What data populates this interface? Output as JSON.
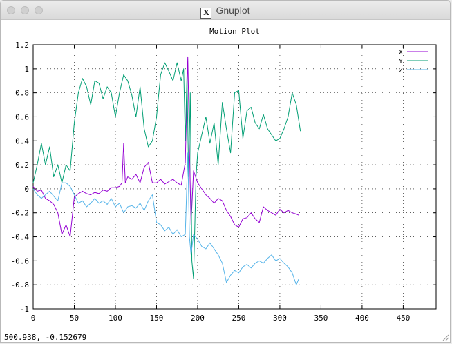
{
  "window": {
    "title": "Gnuplot",
    "app_icon": "x11-icon"
  },
  "status": {
    "coords": "500.938, -0.152679"
  },
  "chart_data": {
    "type": "line",
    "title": "Motion Plot",
    "xlim": [
      0,
      490
    ],
    "ylim": [
      -1,
      1.2
    ],
    "xticks": [
      "0",
      "50",
      "100",
      "150",
      "200",
      "250",
      "300",
      "350",
      "400",
      "450"
    ],
    "xtick_values": [
      0,
      50,
      100,
      150,
      200,
      250,
      300,
      350,
      400,
      450
    ],
    "yticks": [
      "-1",
      "-0.8",
      "-0.6",
      "-0.4",
      "-0.2",
      "0",
      "0.2",
      "0.4",
      "0.6",
      "0.8",
      "1",
      "1.2"
    ],
    "ytick_values": [
      -1,
      -0.8,
      -0.6,
      -0.4,
      -0.2,
      0,
      0.2,
      0.4,
      0.6,
      0.8,
      1,
      1.2
    ],
    "grid": true,
    "legend_position": "top-right",
    "series": [
      {
        "name": "X",
        "color": "#9400d3",
        "x": [
          0,
          5,
          10,
          15,
          20,
          25,
          30,
          35,
          40,
          45,
          50,
          55,
          60,
          65,
          70,
          75,
          80,
          85,
          90,
          95,
          100,
          105,
          108,
          110,
          112,
          115,
          120,
          125,
          130,
          135,
          140,
          145,
          150,
          155,
          160,
          165,
          170,
          175,
          180,
          185,
          188,
          190,
          192,
          195,
          200,
          205,
          210,
          215,
          220,
          225,
          230,
          235,
          240,
          245,
          250,
          255,
          260,
          265,
          270,
          275,
          280,
          285,
          290,
          295,
          300,
          305,
          310,
          315,
          320,
          323
        ],
        "y": [
          0.02,
          -0.02,
          -0.01,
          -0.08,
          -0.1,
          -0.13,
          -0.2,
          -0.38,
          -0.3,
          -0.4,
          -0.07,
          -0.04,
          -0.02,
          -0.04,
          -0.05,
          -0.03,
          -0.04,
          -0.01,
          -0.02,
          0.01,
          0.01,
          0.02,
          0.05,
          0.38,
          0.05,
          0.1,
          0.08,
          0.12,
          0.05,
          0.18,
          0.22,
          0.05,
          0.05,
          0.08,
          0.04,
          0.06,
          0.08,
          0.05,
          0.03,
          0.22,
          1.1,
          0.35,
          -0.3,
          0.15,
          0.05,
          0.0,
          -0.05,
          -0.08,
          -0.12,
          -0.08,
          -0.1,
          -0.18,
          -0.23,
          -0.3,
          -0.32,
          -0.25,
          -0.24,
          -0.2,
          -0.25,
          -0.28,
          -0.15,
          -0.18,
          -0.2,
          -0.22,
          -0.17,
          -0.2,
          -0.18,
          -0.2,
          -0.21,
          -0.22
        ]
      },
      {
        "name": "Y",
        "color": "#009e73",
        "x": [
          0,
          5,
          10,
          15,
          20,
          25,
          30,
          35,
          40,
          45,
          50,
          55,
          60,
          65,
          70,
          75,
          80,
          85,
          90,
          95,
          100,
          105,
          110,
          115,
          120,
          125,
          130,
          135,
          140,
          145,
          150,
          155,
          160,
          165,
          170,
          175,
          180,
          183,
          185,
          187,
          189,
          191,
          193,
          195,
          198,
          200,
          205,
          210,
          215,
          220,
          225,
          230,
          235,
          240,
          245,
          250,
          255,
          260,
          265,
          270,
          275,
          280,
          285,
          290,
          295,
          300,
          305,
          310,
          315,
          320,
          325
        ],
        "y": [
          0.05,
          0.2,
          0.38,
          0.2,
          0.35,
          0.1,
          0.2,
          0.05,
          0.2,
          0.15,
          0.55,
          0.8,
          0.92,
          0.85,
          0.7,
          0.9,
          0.88,
          0.75,
          0.85,
          0.8,
          0.6,
          0.8,
          0.95,
          0.9,
          0.78,
          0.6,
          0.85,
          0.5,
          0.35,
          0.4,
          0.6,
          0.95,
          1.05,
          0.98,
          0.9,
          1.05,
          0.9,
          1.0,
          0.4,
          0.95,
          0.1,
          0.8,
          -0.6,
          -0.75,
          0.1,
          0.3,
          0.45,
          0.6,
          0.38,
          0.55,
          0.2,
          0.72,
          0.5,
          0.3,
          0.8,
          0.82,
          0.42,
          0.65,
          0.68,
          0.55,
          0.5,
          0.62,
          0.5,
          0.45,
          0.4,
          0.42,
          0.5,
          0.6,
          0.8,
          0.7,
          0.48
        ]
      },
      {
        "name": "Z",
        "color": "#56b4e9",
        "x": [
          0,
          5,
          10,
          15,
          20,
          25,
          30,
          35,
          40,
          45,
          50,
          55,
          60,
          65,
          70,
          75,
          80,
          85,
          90,
          95,
          100,
          105,
          110,
          115,
          120,
          125,
          130,
          135,
          140,
          145,
          150,
          155,
          160,
          165,
          170,
          175,
          180,
          185,
          188,
          190,
          192,
          195,
          200,
          205,
          210,
          215,
          220,
          225,
          230,
          235,
          240,
          245,
          250,
          255,
          260,
          265,
          270,
          275,
          280,
          285,
          290,
          295,
          300,
          305,
          310,
          315,
          320,
          323
        ],
        "y": [
          0.0,
          -0.05,
          -0.08,
          -0.05,
          -0.02,
          -0.06,
          -0.1,
          0.05,
          0.05,
          0.02,
          -0.05,
          -0.12,
          -0.1,
          -0.15,
          -0.12,
          -0.08,
          -0.12,
          -0.1,
          -0.13,
          -0.08,
          -0.15,
          -0.12,
          -0.2,
          -0.15,
          -0.14,
          -0.16,
          -0.12,
          -0.18,
          -0.1,
          -0.05,
          -0.28,
          -0.3,
          -0.35,
          -0.32,
          -0.38,
          -0.34,
          -0.4,
          -0.38,
          0.3,
          -0.4,
          -0.55,
          -0.38,
          -0.42,
          -0.48,
          -0.5,
          -0.45,
          -0.5,
          -0.55,
          -0.62,
          -0.78,
          -0.72,
          -0.68,
          -0.7,
          -0.65,
          -0.63,
          -0.66,
          -0.62,
          -0.6,
          -0.62,
          -0.58,
          -0.55,
          -0.6,
          -0.58,
          -0.62,
          -0.65,
          -0.7,
          -0.8,
          -0.75
        ]
      }
    ]
  }
}
